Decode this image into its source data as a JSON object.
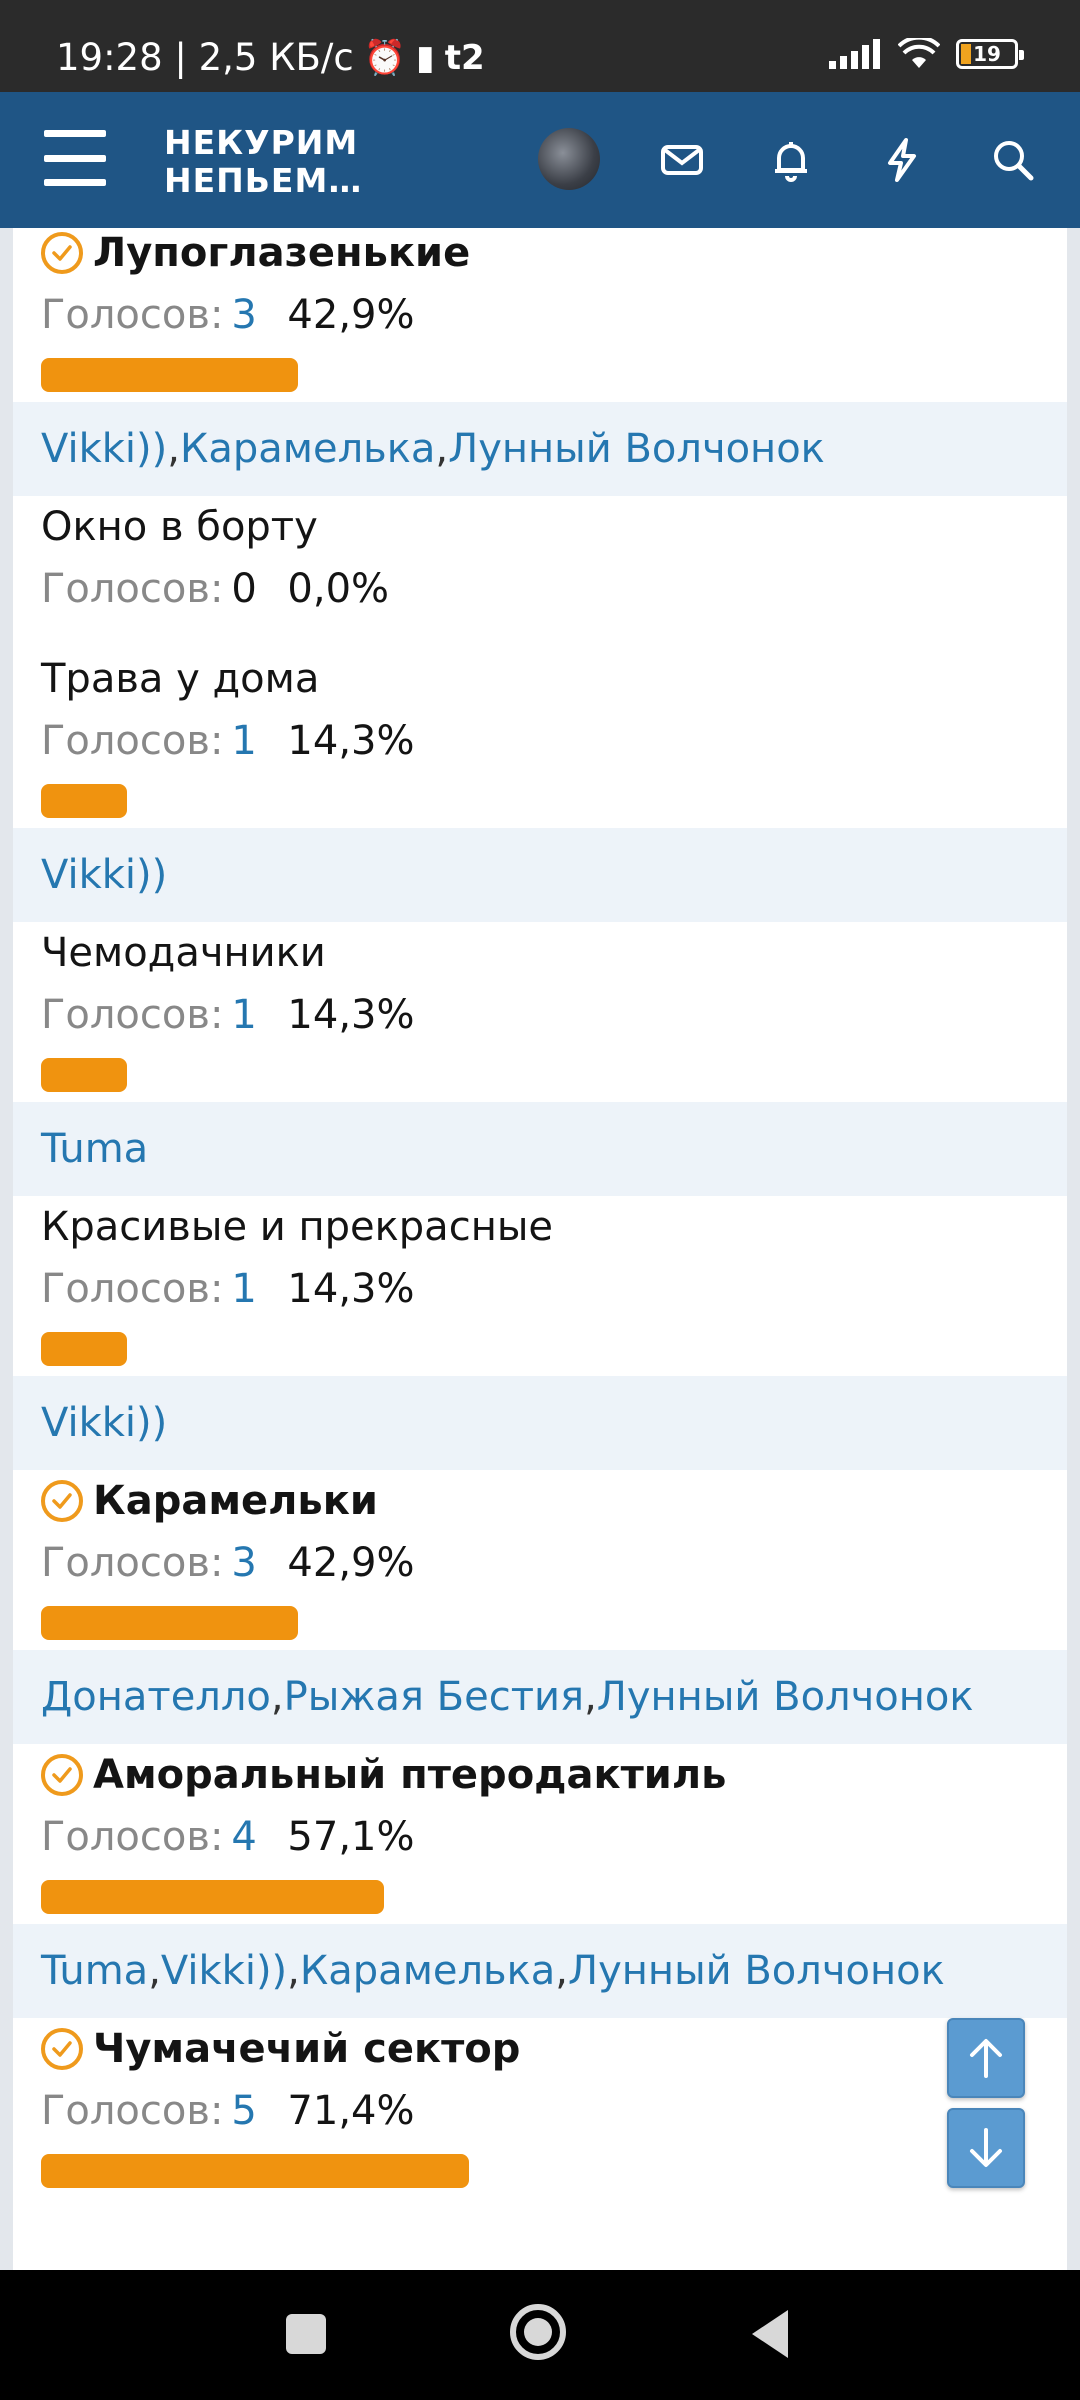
{
  "status_bar": {
    "time_speed": "19:28 | 2,5 КБ/с",
    "carrier": "t2",
    "battery": "19"
  },
  "header": {
    "logo_line1": "НЕКУРИМ",
    "logo_line2": "НЕПЬЕМ…",
    "icons": [
      "menu-icon",
      "avatar",
      "mail-icon",
      "bell-icon",
      "bolt-icon",
      "search-icon"
    ]
  },
  "colors": {
    "accent": "#f0930f",
    "header": "#1f5585",
    "link": "#2577b0",
    "voters_bg": "#edf3f9"
  },
  "votes_label": "Голосов:",
  "poll": [
    {
      "title": "Лупоглазенькие",
      "winner": true,
      "count": "3",
      "percent": "42,9%",
      "share": 0.429,
      "voters": [
        "Vikki))",
        "Карамелька",
        "Лунный Волчонок"
      ]
    },
    {
      "title": "Окно в борту",
      "winner": false,
      "count": "0",
      "percent": "0,0%",
      "share": 0.0,
      "voters": []
    },
    {
      "title": "Трава у дома",
      "winner": false,
      "count": "1",
      "percent": "14,3%",
      "share": 0.143,
      "voters": [
        "Vikki))"
      ]
    },
    {
      "title": "Чемодачники",
      "winner": false,
      "count": "1",
      "percent": "14,3%",
      "share": 0.143,
      "voters": [
        "Tuma"
      ]
    },
    {
      "title": "Красивые и прекрасные",
      "winner": false,
      "count": "1",
      "percent": "14,3%",
      "share": 0.143,
      "voters": [
        "Vikki))"
      ]
    },
    {
      "title": "Карамельки",
      "winner": true,
      "count": "3",
      "percent": "42,9%",
      "share": 0.429,
      "voters": [
        "Донателло",
        "Рыжая Бестия",
        "Лунный Волчонок"
      ]
    },
    {
      "title": "Аморальный птеродактиль",
      "winner": true,
      "count": "4",
      "percent": "57,1%",
      "share": 0.571,
      "voters": [
        "Tuma",
        "Vikki))",
        "Карамелька",
        "Лунный Волчонок"
      ]
    },
    {
      "title": "Чумачечий сектор",
      "winner": true,
      "count": "5",
      "percent": "71,4%",
      "share": 0.714,
      "voters": []
    }
  ]
}
